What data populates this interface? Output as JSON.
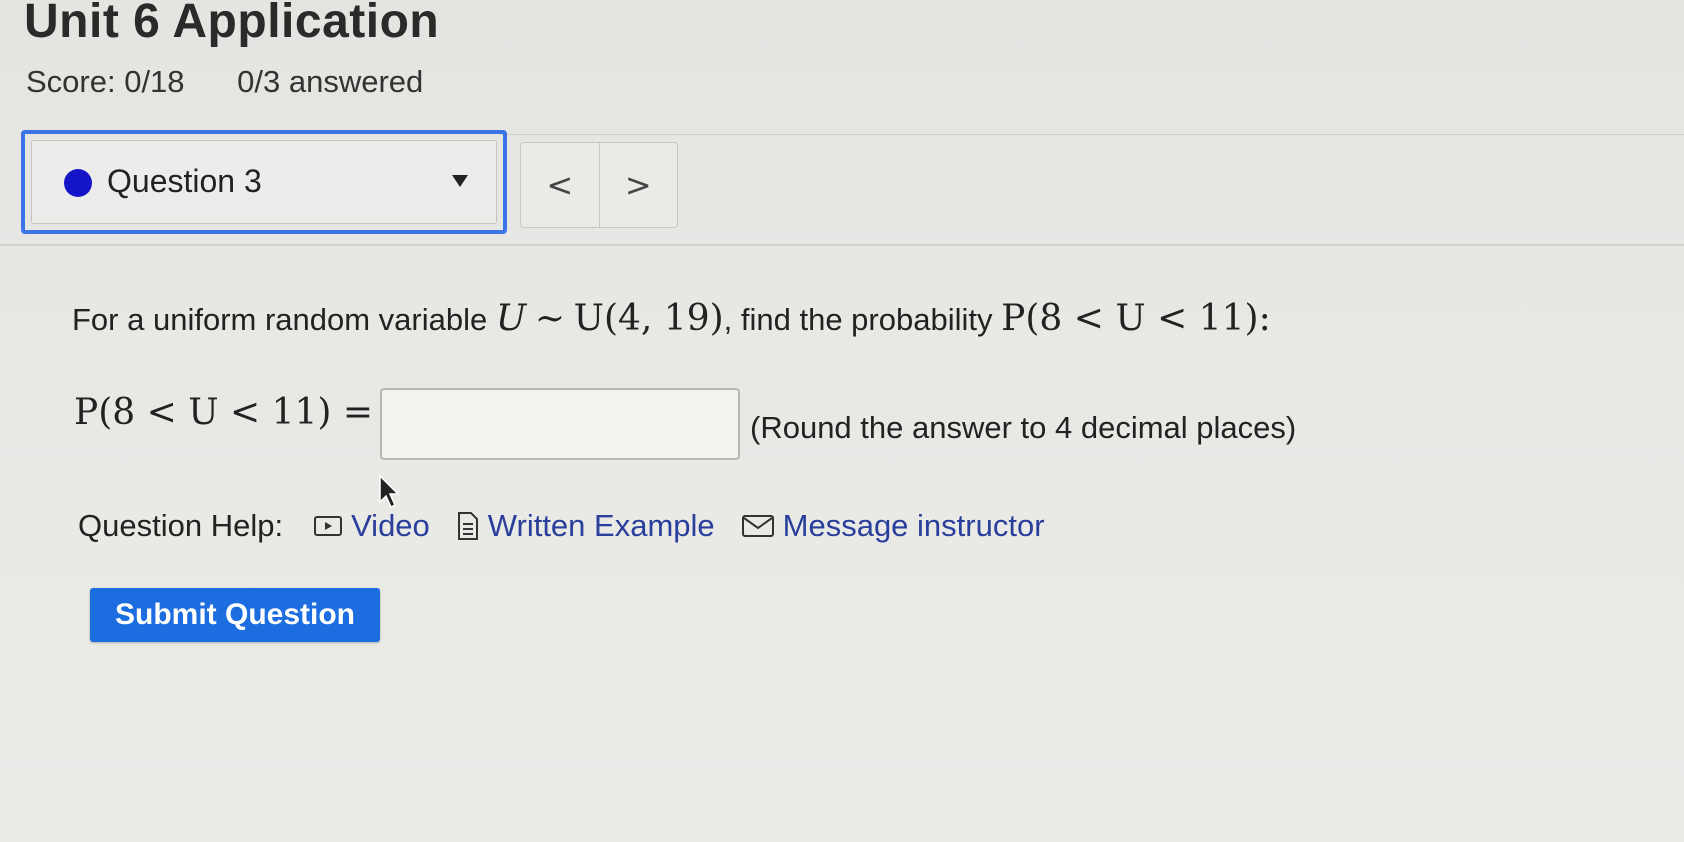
{
  "page": {
    "title": "Unit 6 Application",
    "score": "Score: 0/18",
    "answered": "0/3 answered"
  },
  "question_nav": {
    "selected": "Question 3",
    "prev_label": "<",
    "next_label": ">",
    "status_color": "#1414c8"
  },
  "question": {
    "prompt_prefix": "For a uniform random variable",
    "dist_var": "U",
    "tilde": "∼",
    "dist": "U(4, 19)",
    "prompt_mid": ", find the probability",
    "prob": "P(8 < U < 11)",
    "prompt_suffix": ":",
    "answer_lhs": "P(8 < U < 11) =",
    "answer_value": "",
    "round_note": "(Round the answer to 4 decimal places)"
  },
  "help": {
    "label": "Question Help:",
    "video": "Video",
    "written_example": "Written Example",
    "message": "Message instructor"
  },
  "actions": {
    "submit": "Submit Question"
  },
  "colors": {
    "accent": "#1c6ee0",
    "focus_ring": "#3b74e6",
    "link": "#2a3f9c"
  }
}
